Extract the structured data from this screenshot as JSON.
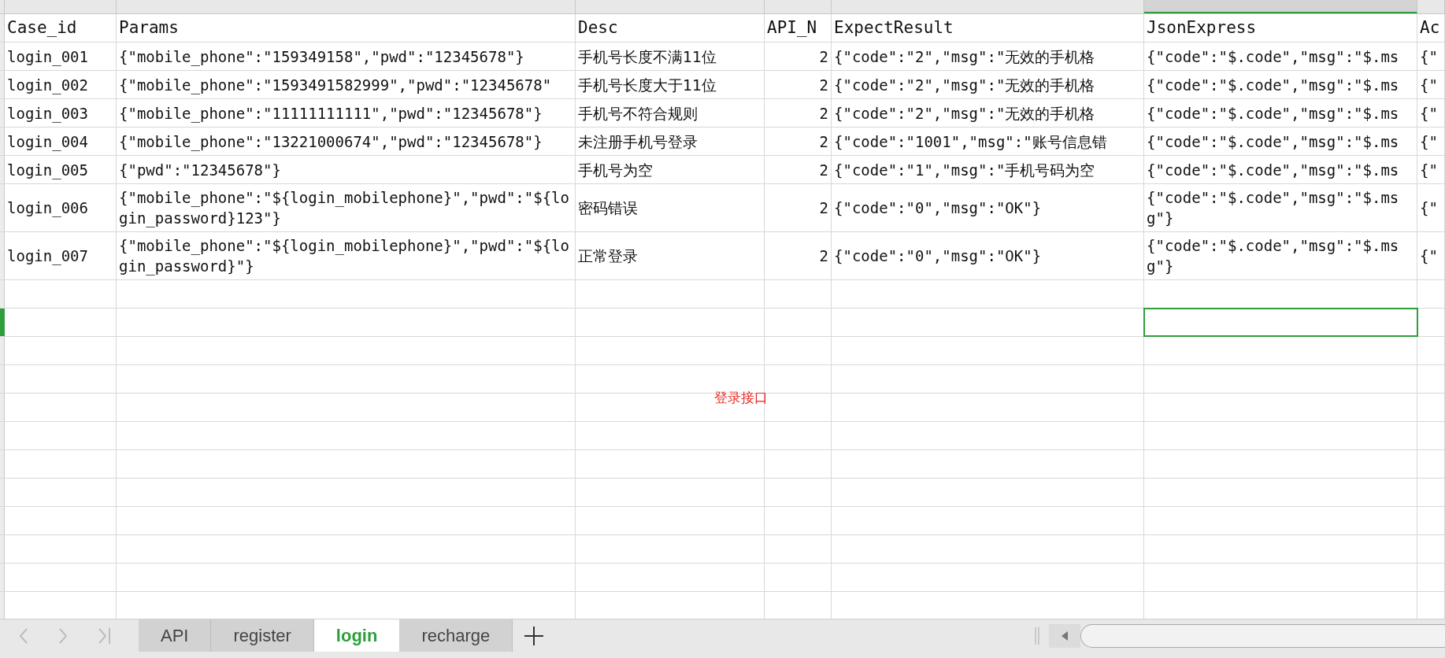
{
  "columns": [
    {
      "selected": false
    },
    {
      "selected": false
    },
    {
      "selected": false
    },
    {
      "selected": false
    },
    {
      "selected": false
    },
    {
      "selected": true
    },
    {
      "selected": false
    }
  ],
  "header_row": [
    "Case_id",
    "Params",
    "Desc",
    "API_N",
    "ExpectResult",
    "JsonExpress",
    "Ac"
  ],
  "rows": [
    {
      "cells": [
        "login_001",
        "{\"mobile_phone\":\"159349158\",\"pwd\":\"12345678\"}",
        "手机号长度不满11位",
        "2",
        "{\"code\":\"2\",\"msg\":\"无效的手机格",
        "{\"code\":\"$.code\",\"msg\":\"$.ms",
        "{\""
      ]
    },
    {
      "cells": [
        "login_002",
        "{\"mobile_phone\":\"1593491582999\",\"pwd\":\"12345678\"",
        "手机号长度大于11位",
        "2",
        "{\"code\":\"2\",\"msg\":\"无效的手机格",
        "{\"code\":\"$.code\",\"msg\":\"$.ms",
        "{\""
      ]
    },
    {
      "cells": [
        "login_003",
        "{\"mobile_phone\":\"11111111111\",\"pwd\":\"12345678\"}",
        "手机号不符合规则",
        "2",
        "{\"code\":\"2\",\"msg\":\"无效的手机格",
        "{\"code\":\"$.code\",\"msg\":\"$.ms",
        "{\""
      ]
    },
    {
      "cells": [
        "login_004",
        "{\"mobile_phone\":\"13221000674\",\"pwd\":\"12345678\"}",
        "未注册手机号登录",
        "2",
        "{\"code\":\"1001\",\"msg\":\"账号信息错",
        "{\"code\":\"$.code\",\"msg\":\"$.ms",
        "{\""
      ]
    },
    {
      "cells": [
        "login_005",
        "{\"pwd\":\"12345678\"}",
        "手机号为空",
        "2",
        "{\"code\":\"1\",\"msg\":\"手机号码为空",
        "{\"code\":\"$.code\",\"msg\":\"$.ms",
        "{\""
      ]
    },
    {
      "cells": [
        "login_006",
        "{\"mobile_phone\":\"${login_mobilephone}\",\"pwd\":\"${login_password}123\"}",
        "密码错误",
        "2",
        "{\"code\":\"0\",\"msg\":\"OK\"}",
        "{\"code\":\"$.code\",\"msg\":\"$.msg\"}",
        "{\""
      ]
    },
    {
      "cells": [
        "login_007",
        "{\"mobile_phone\":\"${login_mobilephone}\",\"pwd\":\"${login_password}\"}",
        "正常登录",
        "2",
        "{\"code\":\"0\",\"msg\":\"OK\"}",
        "{\"code\":\"$.code\",\"msg\":\"$.msg\"}",
        "{\""
      ]
    }
  ],
  "empty_rows": [
    {
      "selected": false
    },
    {
      "selected": true
    },
    {
      "selected": false
    },
    {
      "selected": false
    },
    {
      "selected": false
    },
    {
      "selected": false
    },
    {
      "selected": false
    },
    {
      "selected": false
    },
    {
      "selected": false
    },
    {
      "selected": false
    },
    {
      "selected": false
    },
    {
      "selected": false
    }
  ],
  "note": {
    "text": "登录接口"
  },
  "sheet_tabs": [
    {
      "label": "API",
      "selected": false
    },
    {
      "label": "register",
      "selected": false
    },
    {
      "label": "login",
      "selected": true
    },
    {
      "label": "recharge",
      "selected": false
    }
  ]
}
